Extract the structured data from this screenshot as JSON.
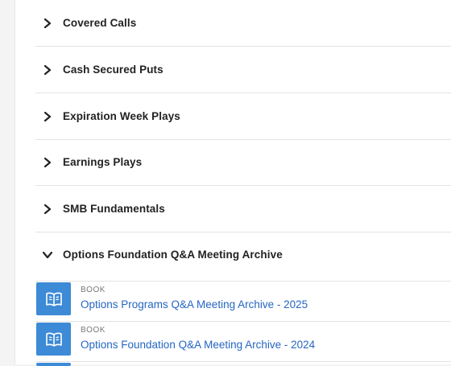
{
  "sections": [
    {
      "label": "Covered Calls",
      "expanded": false
    },
    {
      "label": "Cash Secured Puts",
      "expanded": false
    },
    {
      "label": "Expiration Week Plays",
      "expanded": false
    },
    {
      "label": "Earnings Plays",
      "expanded": false
    },
    {
      "label": "SMB Fundamentals",
      "expanded": false
    },
    {
      "label": "Options Foundation Q&A Meeting Archive",
      "expanded": true
    }
  ],
  "items": [
    {
      "type": "BOOK",
      "title": "Options Programs Q&A Meeting Archive - 2025",
      "icon": "book-icon"
    },
    {
      "type": "BOOK",
      "title": "Options Foundation Q&A Meeting Archive - 2024",
      "icon": "book-icon"
    }
  ],
  "colors": {
    "accent": "#3d8ad6",
    "link": "#2566c2"
  }
}
